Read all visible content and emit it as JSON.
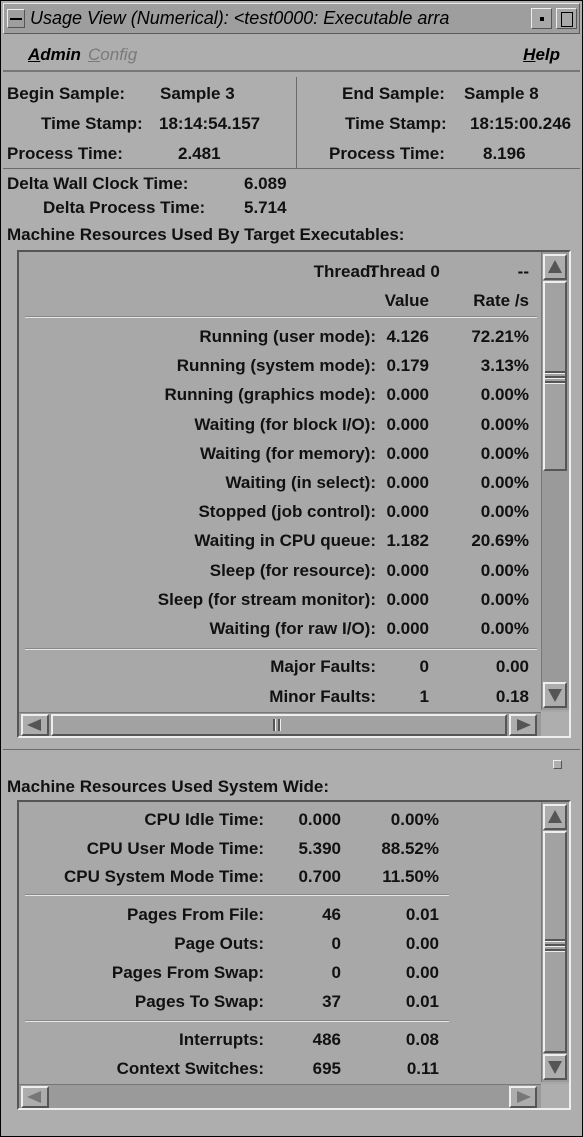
{
  "window": {
    "title": "Usage View (Numerical): <test0000: Executable arra"
  },
  "menubar": {
    "admin": "Admin",
    "config": "Config",
    "help": "Help"
  },
  "samples": {
    "begin_label": "Begin Sample:",
    "begin_value": "Sample 3",
    "end_label": "End Sample:",
    "end_value": "Sample 8",
    "begin_ts_label": "Time Stamp:",
    "begin_ts_value": "18:14:54.157",
    "end_ts_label": "Time Stamp:",
    "end_ts_value": "18:15:00.246",
    "begin_pt_label": "Process Time:",
    "begin_pt_value": "2.481",
    "end_pt_label": "Process Time:",
    "end_pt_value": "8.196",
    "delta_wall_label": "Delta Wall Clock Time:",
    "delta_wall_value": "6.089",
    "delta_proc_label": "Delta Process Time:",
    "delta_proc_value": "5.714"
  },
  "target": {
    "heading": "Machine Resources Used By Target Executables:",
    "thread_label": "Thread:",
    "thread_value": "Thread 0",
    "thread_rate": "--",
    "col_value": "Value",
    "col_rate": "Rate /s",
    "rows": [
      {
        "label": "Running (user mode):",
        "value": "4.126",
        "rate": "72.21%"
      },
      {
        "label": "Running (system mode):",
        "value": "0.179",
        "rate": "3.13%"
      },
      {
        "label": "Running (graphics mode):",
        "value": "0.000",
        "rate": "0.00%"
      },
      {
        "label": "Waiting (for block I/O):",
        "value": "0.000",
        "rate": "0.00%"
      },
      {
        "label": "Waiting (for memory):",
        "value": "0.000",
        "rate": "0.00%"
      },
      {
        "label": "Waiting (in select):",
        "value": "0.000",
        "rate": "0.00%"
      },
      {
        "label": "Stopped (job control):",
        "value": "0.000",
        "rate": "0.00%"
      },
      {
        "label": "Waiting in CPU queue:",
        "value": "1.182",
        "rate": "20.69%"
      },
      {
        "label": "Sleep (for resource):",
        "value": "0.000",
        "rate": "0.00%"
      },
      {
        "label": "Sleep (for stream monitor):",
        "value": "0.000",
        "rate": "0.00%"
      },
      {
        "label": "Waiting (for raw I/O):",
        "value": "0.000",
        "rate": "0.00%"
      }
    ],
    "faults": [
      {
        "label": "Major Faults:",
        "value": "0",
        "rate": "0.00"
      },
      {
        "label": "Minor Faults:",
        "value": "1",
        "rate": "0.18"
      }
    ]
  },
  "system": {
    "heading": "Machine Resources Used System Wide:",
    "cpu": [
      {
        "label": "CPU Idle Time:",
        "value": "0.000",
        "rate": "0.00%"
      },
      {
        "label": "CPU User Mode Time:",
        "value": "5.390",
        "rate": "88.52%"
      },
      {
        "label": "CPU System Mode Time:",
        "value": "0.700",
        "rate": "11.50%"
      }
    ],
    "pages": [
      {
        "label": "Pages From File:",
        "value": "46",
        "rate": "0.01"
      },
      {
        "label": "Page Outs:",
        "value": "0",
        "rate": "0.00"
      },
      {
        "label": "Pages From Swap:",
        "value": "0",
        "rate": "0.00"
      },
      {
        "label": "Pages To Swap:",
        "value": "37",
        "rate": "0.01"
      }
    ],
    "misc": [
      {
        "label": "Interrupts:",
        "value": "486",
        "rate": "0.08"
      },
      {
        "label": "Context Switches:",
        "value": "695",
        "rate": "0.11"
      }
    ]
  }
}
